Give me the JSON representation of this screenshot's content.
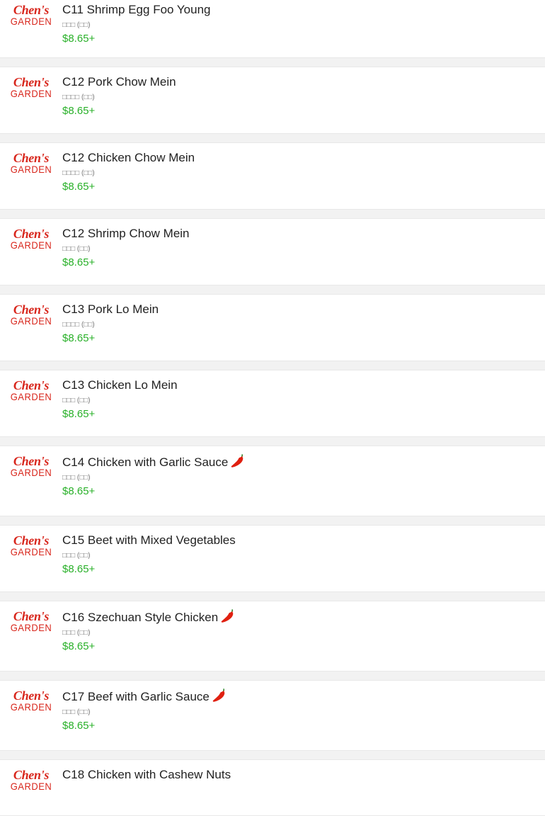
{
  "logo": {
    "line1": "Chen's",
    "line2": "GARDEN",
    "color": "#d8261c"
  },
  "colors": {
    "price": "#28b028",
    "title": "#222222",
    "spicy": "#e02010"
  },
  "items": [
    {
      "name": "C11 Shrimp Egg Foo Young",
      "sub": "□□□ (□□)",
      "price": "$8.65+",
      "spicy": false
    },
    {
      "name": "C12 Pork Chow Mein",
      "sub": "□□□□ (□□)",
      "price": "$8.65+",
      "spicy": false
    },
    {
      "name": "C12 Chicken Chow Mein",
      "sub": "□□□□ (□□)",
      "price": "$8.65+",
      "spicy": false
    },
    {
      "name": "C12 Shrimp Chow Mein",
      "sub": "□□□ (□□)",
      "price": "$8.65+",
      "spicy": false
    },
    {
      "name": "C13 Pork Lo Mein",
      "sub": "□□□□ (□□)",
      "price": "$8.65+",
      "spicy": false
    },
    {
      "name": "C13 Chicken Lo Mein",
      "sub": "□□□ (□□)",
      "price": "$8.65+",
      "spicy": false
    },
    {
      "name": "C14 Chicken with Garlic Sauce",
      "sub": "□□□ (□□)",
      "price": "$8.65+",
      "spicy": true
    },
    {
      "name": "C15 Beet with Mixed Vegetables",
      "sub": "□□□ (□□)",
      "price": "$8.65+",
      "spicy": false
    },
    {
      "name": "C16 Szechuan Style Chicken",
      "sub": "□□□ (□□)",
      "price": "$8.65+",
      "spicy": true
    },
    {
      "name": "C17 Beef with Garlic Sauce",
      "sub": "□□□ (□□)",
      "price": "$8.65+",
      "spicy": true
    },
    {
      "name": "C18 Chicken with Cashew Nuts",
      "sub": "",
      "price": "",
      "spicy": false
    }
  ]
}
